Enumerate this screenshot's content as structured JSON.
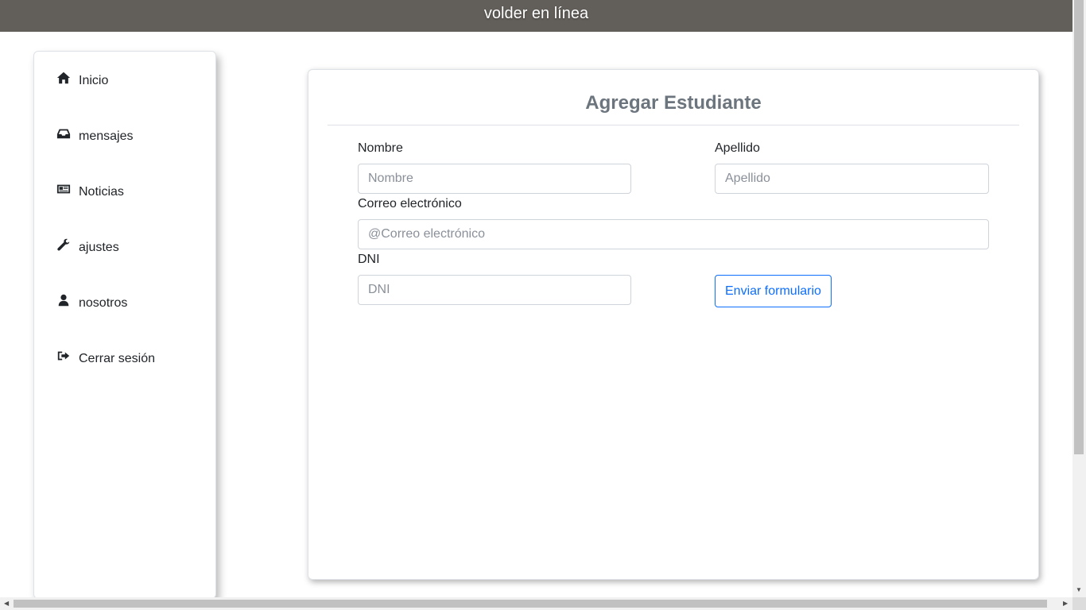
{
  "app": {
    "title": "volder en línea"
  },
  "sidebar": {
    "items": [
      {
        "label": "Inicio",
        "icon": "home-icon"
      },
      {
        "label": "mensajes",
        "icon": "inbox-icon"
      },
      {
        "label": "Noticias",
        "icon": "newspaper-icon"
      },
      {
        "label": "ajustes",
        "icon": "wrench-icon"
      },
      {
        "label": "nosotros",
        "icon": "user-icon"
      },
      {
        "label": "Cerrar sesión",
        "icon": "sign-out-icon"
      }
    ]
  },
  "form": {
    "title": "Agregar Estudiante",
    "nombre": {
      "label": "Nombre",
      "placeholder": "Nombre",
      "value": ""
    },
    "apellido": {
      "label": "Apellido",
      "placeholder": "Apellido",
      "value": ""
    },
    "correo": {
      "label": "Correo electrónico",
      "placeholder": "@Correo electrónico",
      "value": ""
    },
    "dni": {
      "label": "DNI",
      "placeholder": "DNI",
      "value": ""
    },
    "submit_label": "Enviar formulario"
  },
  "colors": {
    "topbar": "#625e5a",
    "title_text": "#6c757d",
    "accent": "#0d6efd"
  }
}
